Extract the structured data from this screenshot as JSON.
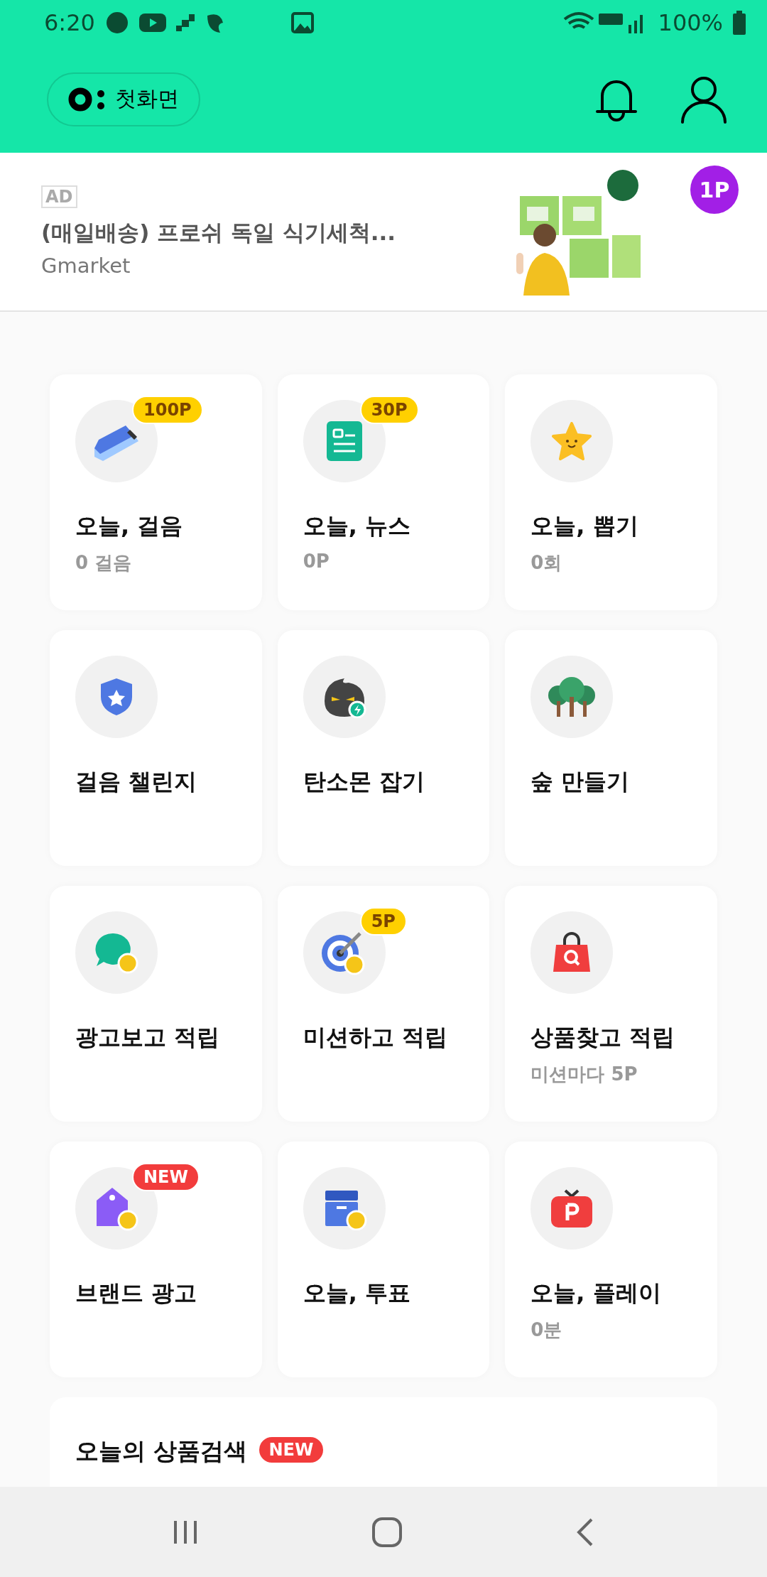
{
  "status_bar": {
    "time": "6:20",
    "battery": "100%"
  },
  "header": {
    "home_button": "첫화면"
  },
  "ad": {
    "label": "AD",
    "title": "(매일배송) 프로쉬 독일 식기세척...",
    "seller": "Gmarket",
    "points_badge": "1P"
  },
  "cards": [
    {
      "badge": {
        "kind": "points",
        "text": "100P"
      },
      "title": "오늘, 걸음",
      "subtitle": "0 걸음"
    },
    {
      "badge": {
        "kind": "points",
        "text": "30P"
      },
      "title": "오늘, 뉴스",
      "subtitle": "0P"
    },
    {
      "title": "오늘, 뽑기",
      "subtitle": "0회"
    },
    {
      "title": "걸음 챌린지"
    },
    {
      "title": "탄소몬 잡기"
    },
    {
      "title": "숲 만들기"
    },
    {
      "title": "광고보고 적립"
    },
    {
      "badge": {
        "kind": "points",
        "text": "5P"
      },
      "title": "미션하고 적립"
    },
    {
      "title": "상품찾고 적립",
      "subtitle": "미션마다 5P"
    },
    {
      "badge": {
        "kind": "new",
        "text": "NEW"
      },
      "title": "브랜드 광고"
    },
    {
      "title": "오늘, 투표"
    },
    {
      "title": "오늘, 플레이",
      "subtitle": "0분"
    }
  ],
  "search_section": {
    "title": "오늘의 상품검색",
    "badge": {
      "kind": "new",
      "text": "NEW"
    }
  }
}
